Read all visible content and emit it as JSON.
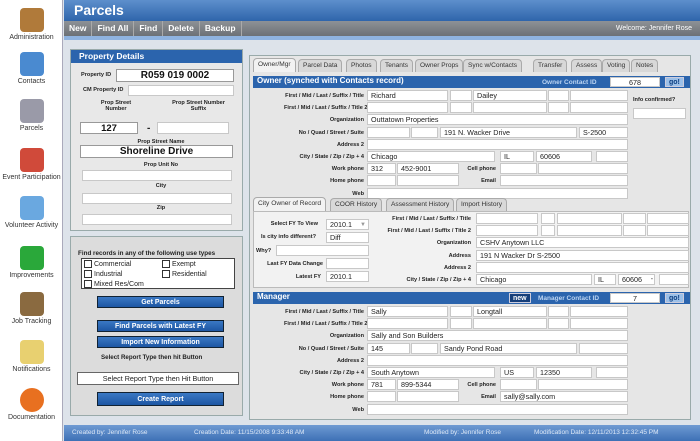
{
  "sidebar": {
    "items": [
      "Administration",
      "Contacts",
      "Parcels",
      "Event Participation",
      "Volunteer Activity",
      "Improvements",
      "Job Tracking",
      "Notifications",
      "Documentation"
    ]
  },
  "header": {
    "title": "Parcels",
    "welcome": "Welcome: Jennifer Rose",
    "toolbar": [
      "New",
      "Find All",
      "Find",
      "Delete",
      "Backup"
    ]
  },
  "property": {
    "title": "Property Details",
    "property_id_label": "Property ID",
    "property_id": "R059 019 0002",
    "cm_label": "CM Property ID",
    "cm_value": "",
    "street_number_label": "Prop Street Number",
    "street_number": "127",
    "dash": "-",
    "suffix_label": "Prop Street Number Suffix",
    "suffix": "",
    "street_name_label": "Prop Street Name",
    "street_name": "Shoreline Drive",
    "unit_label": "Prop Unit No",
    "unit": "",
    "city_label": "City",
    "city": "",
    "zip_label": "Zip",
    "zip": ""
  },
  "find": {
    "heading": "Find records in any of the following use types",
    "use_types": [
      "Commercial",
      "Exempt",
      "Industrial",
      "Residential",
      "Mixed Res/Com"
    ],
    "get_parcels": "Get Parcels",
    "latest_fy": "Find Parcels with Latest FY",
    "import": "Import New Information",
    "report_label": "Select Report Type then hit Button",
    "report_select": "Select Report Type then Hit Button",
    "create_report": "Create Report"
  },
  "tabs": [
    "Owner/Mgr",
    "Parcel Data",
    "Photos",
    "Tenants",
    "Owner Props",
    "Sync w/Contacts",
    "Transfer",
    "Assess",
    "Voting",
    "Notes"
  ],
  "labels": {
    "name": "First / Mid / Last / Suffix / Title",
    "name2": "First / Mid / Last / Suffix / Title 2",
    "org": "Organization",
    "street": "No / Quad / Street / Suite",
    "addr2": "Address 2",
    "city": "City / State / Zip / Zip + 4",
    "work": "Work phone",
    "home": "Home phone",
    "web": "Web",
    "cell": "Cell phone",
    "email": "Email",
    "address": "Address"
  },
  "owner": {
    "header": "Owner (synched with Contacts record)",
    "contact_id_label": "Owner Contact ID",
    "contact_id": "678",
    "go": "go!",
    "info_confirmed_label": "Info confirmed?",
    "info_confirmed": "",
    "first": "Richard",
    "mid": "",
    "last": "Dailey",
    "suffix": "",
    "title": "",
    "first2": "",
    "mid2": "",
    "last2": "",
    "suffix2": "",
    "title2": "",
    "org": "Outtatown Properties",
    "no": "",
    "quad": "",
    "street": "191 N. Wacker Drive",
    "suite": "S-2500",
    "addr2": "",
    "city": "Chicago",
    "state": "IL",
    "zip": "60606",
    "zip4": "",
    "work_area": "312",
    "work": "452-9001",
    "cell_area": "",
    "cell": "",
    "home_area": "",
    "home": "",
    "email": "",
    "web": ""
  },
  "coor": {
    "tabs": [
      "City Owner of Record",
      "COOR History",
      "Assessment History",
      "Import History"
    ],
    "fy_label": "Select FY To View",
    "fy": "2010.1",
    "diff_label": "Is city info different?",
    "diff": "Diff",
    "why_label": "Why?",
    "why": "",
    "last_change_label": "Last FY Data Change",
    "last_change": "",
    "latest_label": "Latest FY",
    "latest": "2010.1",
    "org": "CSHV Anytown LLC",
    "address": "191 N Wacker Dr S-2500",
    "addr2": "",
    "city": "Chicago",
    "state": "IL",
    "zip": "60606",
    "zip_dash": "-",
    "zip4": ""
  },
  "manager": {
    "header": "Manager",
    "new": "new",
    "contact_id_label": "Manager Contact ID",
    "contact_id": "7",
    "go": "go!",
    "first": "Sally",
    "mid": "",
    "last": "Longtall",
    "suffix": "",
    "title": "",
    "org": "Sally and Son Builders",
    "no": "145",
    "quad": "",
    "street": "Sandy Pond Road",
    "suite": "",
    "addr2": "",
    "city": "South Anytown",
    "state": "US",
    "zip": "12350",
    "zip4": "",
    "work_area": "781",
    "work": "899-5344",
    "cell_area": "",
    "cell": "",
    "home_area": "",
    "home": "",
    "email": "sally@sally.com",
    "web": ""
  },
  "footer": {
    "created_by": "Created by: Jennifer Rose",
    "creation_date": "Creation Date: 11/15/2008 9:33:48 AM",
    "modified_by": "Modified by: Jennifer Rose",
    "modification_date": "Modification Date: 12/11/2013 12:32:45 PM"
  },
  "colors": {
    "accent": "#2b64ad",
    "toolbar": "#7d8186"
  }
}
